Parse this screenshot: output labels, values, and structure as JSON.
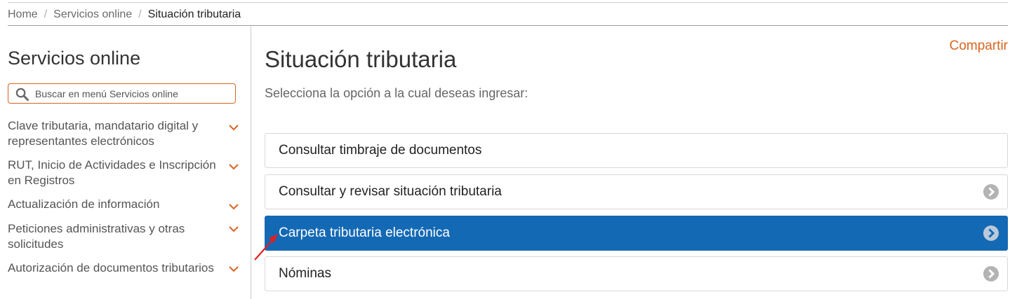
{
  "breadcrumb": {
    "items": [
      "Home",
      "Servicios online",
      "Situación tributaria"
    ],
    "separator": "/"
  },
  "sidebar": {
    "title": "Servicios online",
    "search": {
      "placeholder": "Buscar en menú Servicios online",
      "value": ""
    },
    "items": [
      {
        "label": "Clave tributaria, mandatario digital y representantes electrónicos"
      },
      {
        "label": "RUT, Inicio de Actividades e Inscripción en Registros"
      },
      {
        "label": "Actualización de información"
      },
      {
        "label": "Peticiones administrativas y otras solicitudes"
      },
      {
        "label": "Autorización de documentos tributarios"
      }
    ]
  },
  "main": {
    "title": "Situación tributaria",
    "subtitle": "Selecciona la opción a la cual deseas ingresar:",
    "share_label": "Compartir",
    "options": [
      {
        "label": "Consultar timbraje de documentos",
        "has_arrow": false
      },
      {
        "label": "Consultar y revisar situación tributaria",
        "has_arrow": true
      },
      {
        "label": "Carpeta tributaria electrónica",
        "has_arrow": true,
        "active": true
      },
      {
        "label": "Nóminas",
        "has_arrow": true
      }
    ]
  },
  "icons": {
    "search": "search-icon",
    "menu_expand": "chevron-down-icon",
    "option_arrow": "chevron-right-circle-icon"
  },
  "colors": {
    "accent_orange": "#d9641e",
    "active_blue": "#1469b4",
    "arrow_gray": "#b3b3b3",
    "annotation_red": "#e0201f"
  }
}
